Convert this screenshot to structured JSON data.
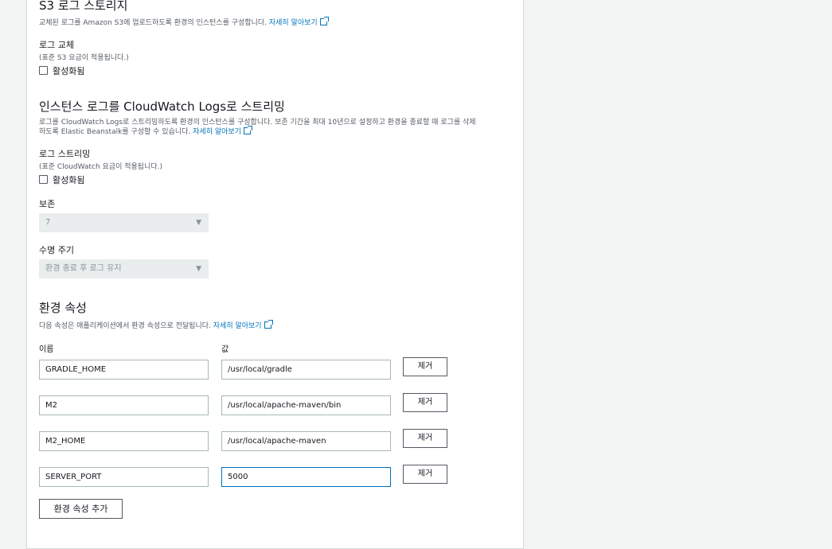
{
  "s3_section": {
    "title": "S3 로그 스토리지",
    "description": "교체된 로그를 Amazon S3에 업로드하도록 환경의 인스턴스를 구성합니다.",
    "learn_more": "자세히 알아보기",
    "rotation_label": "로그 교체",
    "rotation_note": "(표준 S3 요금이 적용됩니다.)",
    "rotation_checkbox": "활성화됨"
  },
  "cloudwatch_section": {
    "title": "인스턴스 로그를 CloudWatch Logs로 스트리밍",
    "description_line1": "로그를 CloudWatch Logs로 스트리밍하도록 환경의 인스턴스를 구성합니다. 보존 기간을 최대 10년으로 설정하고 환경을 종료할 때 로그를 삭제",
    "description_line2": "하도록 Elastic Beanstalk를 구성할 수 있습니다.",
    "learn_more": "자세히 알아보기",
    "streaming_label": "로그 스트리밍",
    "streaming_note": "(표준 CloudWatch 요금이 적용됩니다.)",
    "streaming_checkbox": "활성화됨",
    "retention_label": "보존",
    "retention_value": "7",
    "lifecycle_label": "수명 주기",
    "lifecycle_value": "환경 종료 후 로그 유지"
  },
  "env_section": {
    "title": "환경 속성",
    "description": "다음 속성은 애플리케이션에서 환경 속성으로 전달됩니다.",
    "learn_more": "자세히 알아보기",
    "name_header": "이름",
    "value_header": "값",
    "remove_label": "제거",
    "add_button": "환경 속성 추가",
    "properties": [
      {
        "name": "GRADLE_HOME",
        "value": "/usr/local/gradle"
      },
      {
        "name": "M2",
        "value": "/usr/local/apache-maven/bin"
      },
      {
        "name": "M2_HOME",
        "value": "/usr/local/apache-maven"
      },
      {
        "name": "SERVER_PORT",
        "value": "5000"
      }
    ]
  },
  "colors": {
    "link": "#0073bb",
    "background": "#f2f3f3",
    "panel": "#ffffff",
    "focus_border": "#0073bb"
  }
}
